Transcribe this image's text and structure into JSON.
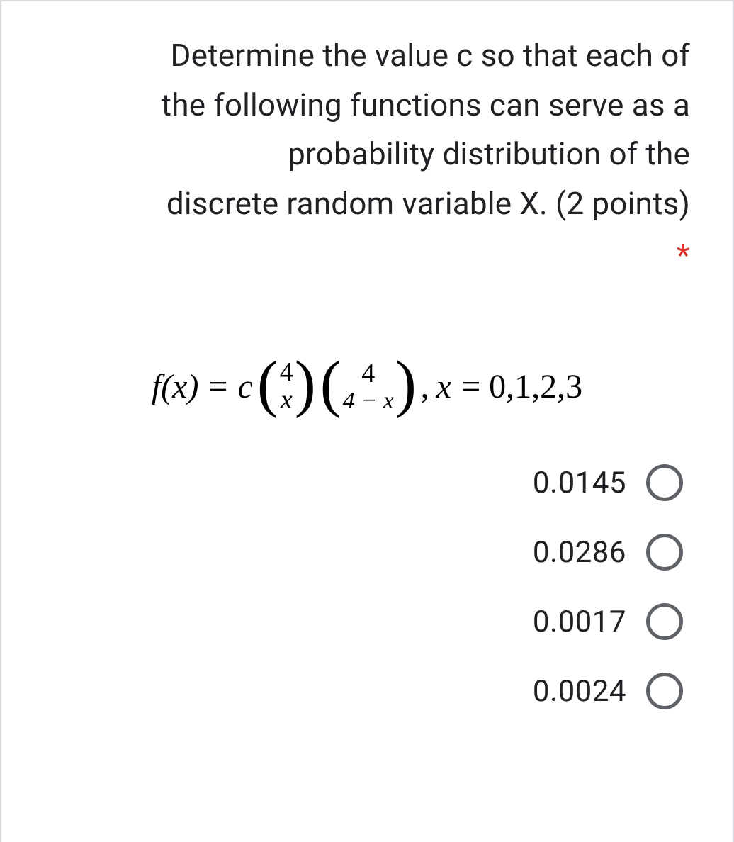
{
  "question": {
    "line1": "Determine the value c so that each of",
    "line2": "the following functions can serve as a",
    "line3": "probability distribution of the",
    "line4": "discrete random variable X. (2 points)",
    "required_marker": "*"
  },
  "formula": {
    "lhs": "f(x)",
    "equals": "=",
    "coef": "c",
    "binom1_top": "4",
    "binom1_bottom": "x",
    "binom2_top": "4",
    "binom2_bottom": "4 − x",
    "comma": ",",
    "var": "x",
    "domain": "= 0,1,2,3"
  },
  "options": [
    {
      "label": "0.0145"
    },
    {
      "label": "0.0286"
    },
    {
      "label": "0.0017"
    },
    {
      "label": "0.0024"
    }
  ]
}
